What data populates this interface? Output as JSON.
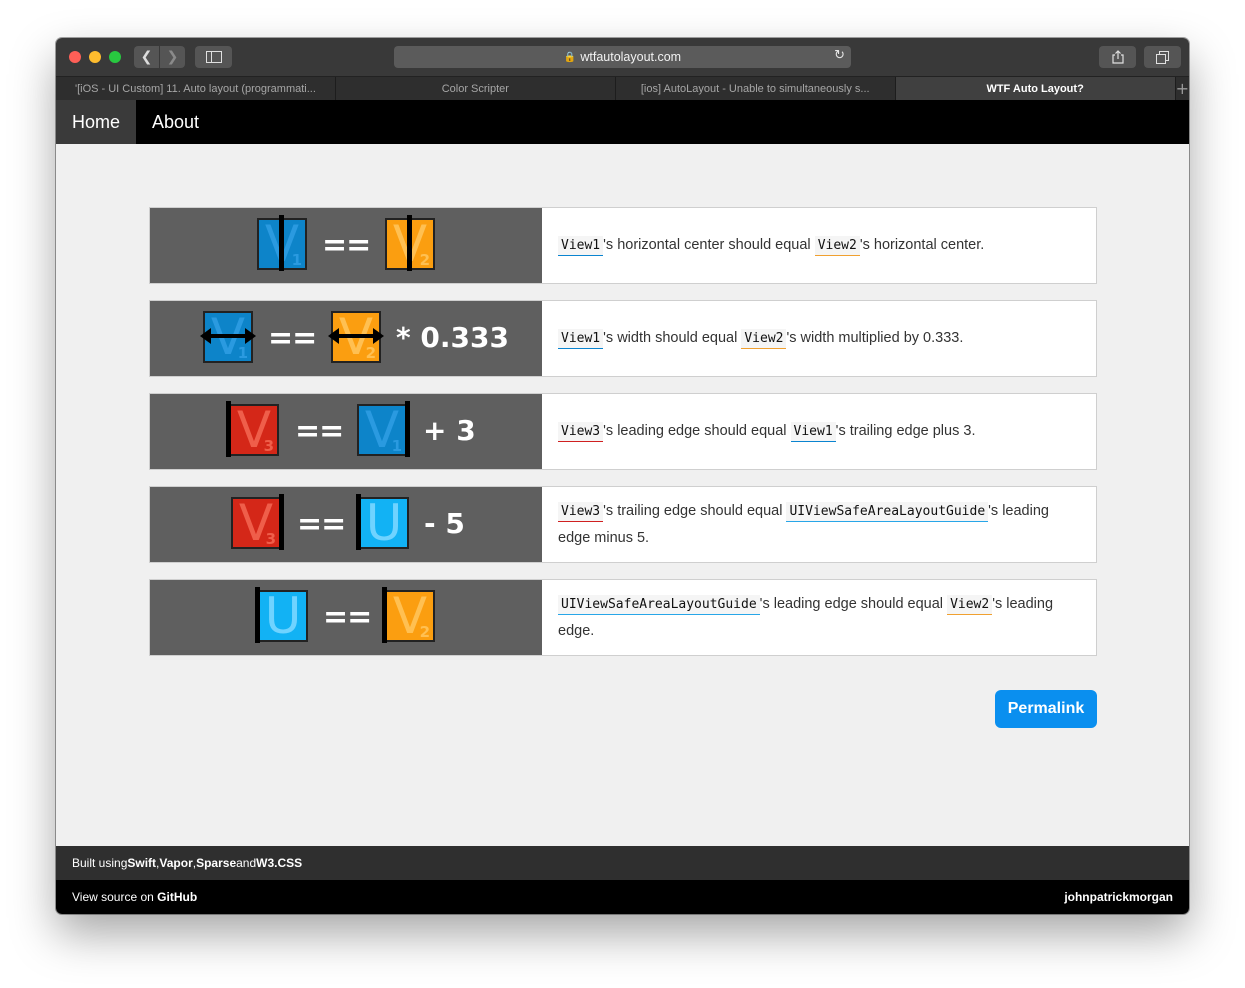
{
  "browser": {
    "url": "wtfautolayout.com",
    "tabs": [
      {
        "label": "'[iOS - UI Custom] 11. Auto layout (programmati...",
        "active": false
      },
      {
        "label": "Color Scripter",
        "active": false
      },
      {
        "label": "[ios] AutoLayout - Unable to simultaneously s...",
        "active": false
      },
      {
        "label": "WTF Auto Layout?",
        "active": true
      }
    ]
  },
  "nav": {
    "home": "Home",
    "about": "About"
  },
  "rows": [
    {
      "visual": {
        "eq": "==",
        "suffix": ""
      },
      "desc": {
        "a": "View1",
        "t1": "'s horizontal center should equal ",
        "b": "View2",
        "t2": "'s horizontal center."
      }
    },
    {
      "visual": {
        "eq": "==",
        "suffix": "* 0.333"
      },
      "desc": {
        "a": "View1",
        "t1": "'s width should equal ",
        "b": "View2",
        "t2": "'s width multiplied by 0.333."
      }
    },
    {
      "visual": {
        "eq": "==",
        "suffix": "+ 3"
      },
      "desc": {
        "a": "View3",
        "t1": "'s leading edge should equal ",
        "b": "View1",
        "t2": "'s trailing edge plus 3."
      }
    },
    {
      "visual": {
        "eq": "==",
        "suffix": "- 5"
      },
      "desc": {
        "a": "View3",
        "t1": "'s trailing edge should equal ",
        "b": "UIViewSafeAreaLayoutGuide",
        "t2": "'s leading edge minus 5."
      }
    },
    {
      "visual": {
        "eq": "==",
        "suffix": ""
      },
      "desc": {
        "a": "UIViewSafeAreaLayoutGuide",
        "t1": "'s leading edge should equal ",
        "b": "View2",
        "t2": "'s leading edge."
      }
    }
  ],
  "views": {
    "view1": {
      "letter": "V",
      "sub": "1",
      "color": "#0d84c9"
    },
    "view2": {
      "letter": "V",
      "sub": "2",
      "color": "#fb9e10"
    },
    "view3": {
      "letter": "V",
      "sub": "3",
      "color": "#d42718"
    },
    "safe_area": {
      "letter": "U",
      "color": "#12b2f4"
    }
  },
  "permalink": "Permalink",
  "footer": {
    "built_prefix": "Built using ",
    "swift": "Swift",
    "sep1": ", ",
    "vapor": "Vapor",
    "sep2": ", ",
    "sparse": "Sparse",
    "and": " and ",
    "w3css": "W3.CSS",
    "view_source_prefix": "View source on ",
    "github": "GitHub",
    "author": "johnpatrickmorgan"
  }
}
